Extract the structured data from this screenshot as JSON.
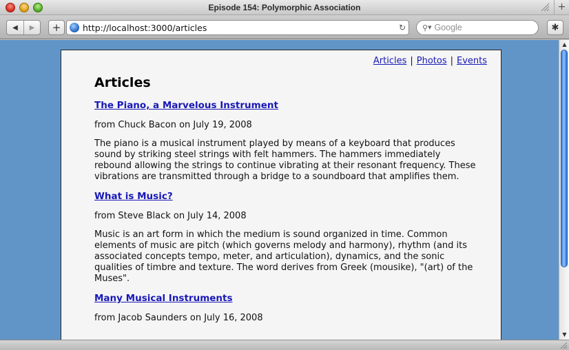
{
  "window": {
    "title": "Episode 154: Polymorphic Association"
  },
  "toolbar": {
    "back_glyph": "◀",
    "forward_glyph": "▶",
    "add_glyph": "+",
    "url": "http://localhost:3000/articles",
    "reload_glyph": "↻",
    "search_placeholder": "Google",
    "bug_glyph": "✱"
  },
  "nav": {
    "links": [
      "Articles",
      "Photos",
      "Events"
    ],
    "separator": "|"
  },
  "page": {
    "heading": "Articles",
    "articles": [
      {
        "title": "The Piano, a Marvelous Instrument",
        "byline": "from Chuck Bacon on July 19, 2008",
        "body": "The piano is a musical instrument played by means of a keyboard that produces sound by striking steel strings with felt hammers. The hammers immediately rebound allowing the strings to continue vibrating at their resonant frequency. These vibrations are transmitted through a bridge to a soundboard that amplifies them."
      },
      {
        "title": "What is Music?",
        "byline": "from Steve Black on July 14, 2008",
        "body": "Music is an art form in which the medium is sound organized in time. Common elements of music are pitch (which governs melody and harmony), rhythm (and its associated concepts tempo, meter, and articulation), dynamics, and the sonic qualities of timbre and texture. The word derives from Greek (mousike), \"(art) of the Muses\"."
      },
      {
        "title": "Many Musical Instruments",
        "byline": "from Jacob Saunders on July 16, 2008"
      }
    ]
  },
  "colors": {
    "background": "#6195c8",
    "link": "#1818b8",
    "page": "#f5f5f5"
  },
  "icons": {
    "globe": "globe-icon",
    "search": "magnifier-icon",
    "reload": "reload-icon",
    "bug": "bug-icon"
  }
}
